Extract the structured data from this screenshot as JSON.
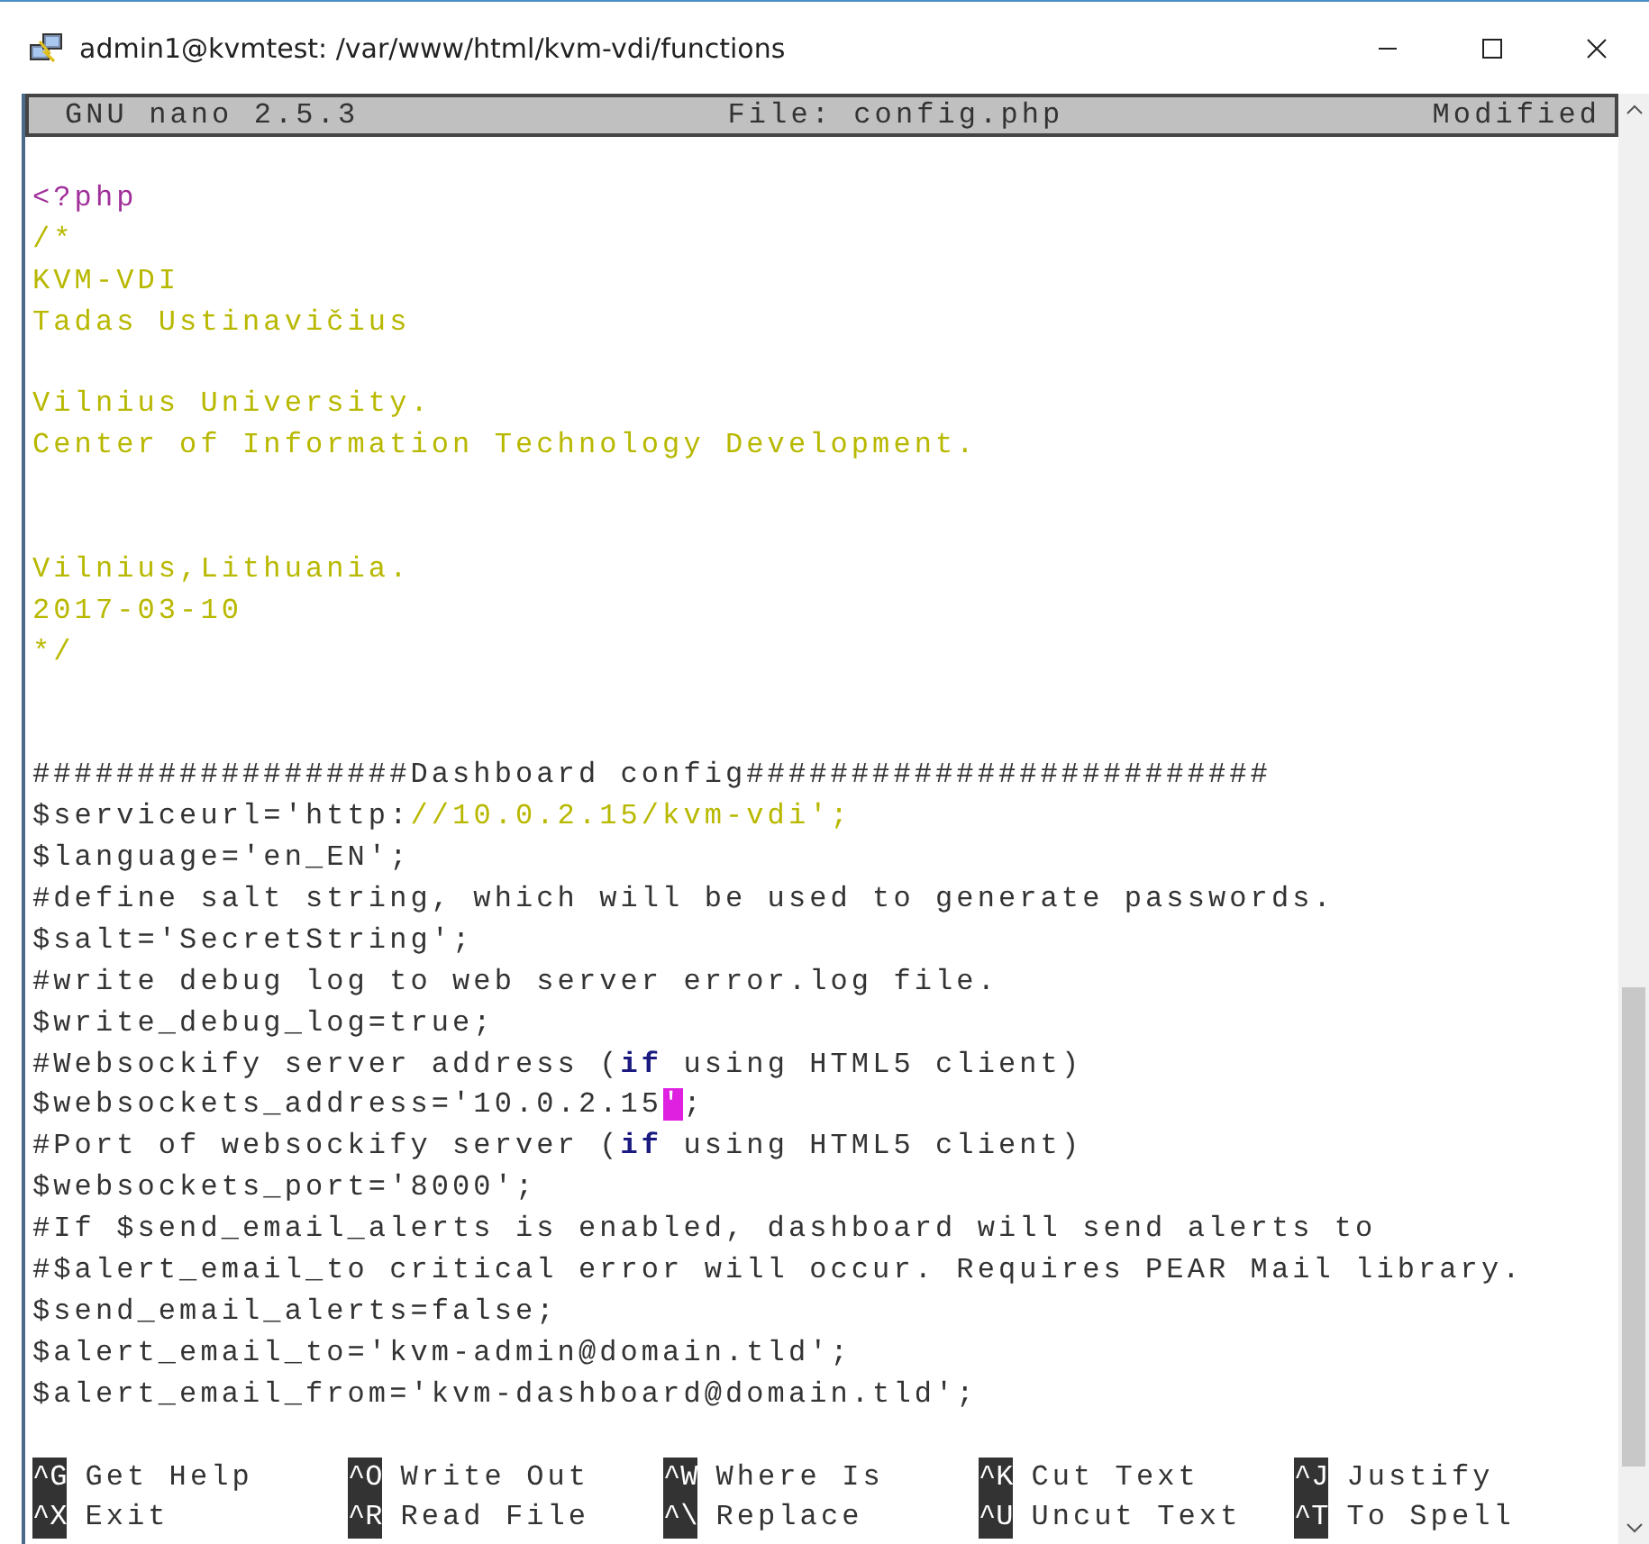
{
  "window": {
    "title": "admin1@kvmtest: /var/www/html/kvm-vdi/functions"
  },
  "status_bar": {
    "version": "GNU nano 2.5.3",
    "file": "File: config.php",
    "state": "Modified"
  },
  "lines": [
    {
      "kind": "blank"
    },
    {
      "kind": "code",
      "segments": [
        {
          "text": "<?php",
          "kind": "tag"
        }
      ]
    },
    {
      "kind": "code",
      "segments": [
        {
          "text": "/*",
          "kind": "comment"
        }
      ]
    },
    {
      "kind": "code",
      "segments": [
        {
          "text": "KVM-VDI",
          "kind": "comment"
        }
      ]
    },
    {
      "kind": "code",
      "segments": [
        {
          "text": "Tadas Ustinavičius",
          "kind": "comment"
        }
      ]
    },
    {
      "kind": "blank"
    },
    {
      "kind": "code",
      "segments": [
        {
          "text": "Vilnius University.",
          "kind": "comment"
        }
      ]
    },
    {
      "kind": "code",
      "segments": [
        {
          "text": "Center of Information Technology Development.",
          "kind": "comment"
        }
      ]
    },
    {
      "kind": "blank"
    },
    {
      "kind": "blank"
    },
    {
      "kind": "code",
      "segments": [
        {
          "text": "Vilnius,Lithuania.",
          "kind": "comment"
        }
      ]
    },
    {
      "kind": "code",
      "segments": [
        {
          "text": "2017-03-10",
          "kind": "comment"
        }
      ]
    },
    {
      "kind": "code",
      "segments": [
        {
          "text": "*/",
          "kind": "comment"
        }
      ]
    },
    {
      "kind": "blank"
    },
    {
      "kind": "blank"
    },
    {
      "kind": "code",
      "segments": [
        {
          "text": "##################Dashboard config#########################",
          "kind": "plain"
        }
      ]
    },
    {
      "kind": "code",
      "segments": [
        {
          "text": "$serviceurl='http:",
          "kind": "plain"
        },
        {
          "text": "//10.0.2.15/kvm-vdi';",
          "kind": "comment"
        }
      ]
    },
    {
      "kind": "code",
      "segments": [
        {
          "text": "$language='en_EN';",
          "kind": "plain"
        }
      ]
    },
    {
      "kind": "code",
      "segments": [
        {
          "text": "#define salt string, which will be used to generate passwords.",
          "kind": "plain"
        }
      ]
    },
    {
      "kind": "code",
      "segments": [
        {
          "text": "$salt='SecretString';",
          "kind": "plain"
        }
      ]
    },
    {
      "kind": "code",
      "segments": [
        {
          "text": "#write debug log to web server error.log file.",
          "kind": "plain"
        }
      ]
    },
    {
      "kind": "code",
      "segments": [
        {
          "text": "$write_debug_log=true;",
          "kind": "plain"
        }
      ]
    },
    {
      "kind": "code",
      "segments": [
        {
          "text": "#Websockify server address (",
          "kind": "plain"
        },
        {
          "text": "if",
          "kind": "keyword"
        },
        {
          "text": " using HTML5 client)",
          "kind": "plain"
        }
      ]
    },
    {
      "kind": "code",
      "segments": [
        {
          "text": "$websockets_address='10.0.2.15",
          "kind": "plain"
        },
        {
          "text": "'",
          "kind": "cursor"
        },
        {
          "text": ";",
          "kind": "plain"
        }
      ]
    },
    {
      "kind": "code",
      "segments": [
        {
          "text": "#Port of websockify server (",
          "kind": "plain"
        },
        {
          "text": "if",
          "kind": "keyword"
        },
        {
          "text": " using HTML5 client)",
          "kind": "plain"
        }
      ]
    },
    {
      "kind": "code",
      "segments": [
        {
          "text": "$websockets_port='8000';",
          "kind": "plain"
        }
      ]
    },
    {
      "kind": "code",
      "segments": [
        {
          "text": "#If $send_email_alerts is enabled, dashboard will send alerts to",
          "kind": "plain"
        }
      ]
    },
    {
      "kind": "code",
      "segments": [
        {
          "text": "#$alert_email_to critical error will occur. Requires PEAR Mail library.",
          "kind": "plain"
        }
      ]
    },
    {
      "kind": "code",
      "segments": [
        {
          "text": "$send_email_alerts=false;",
          "kind": "plain"
        }
      ]
    },
    {
      "kind": "code",
      "segments": [
        {
          "text": "$alert_email_to='kvm-admin@domain.tld';",
          "kind": "plain"
        }
      ]
    },
    {
      "kind": "code",
      "segments": [
        {
          "text": "$alert_email_from='kvm-dashboard@domain.tld';",
          "kind": "plain"
        }
      ]
    },
    {
      "kind": "blank"
    }
  ],
  "shortcuts": [
    [
      {
        "key": "^G",
        "label": "Get Help"
      },
      {
        "key": "^O",
        "label": "Write Out"
      },
      {
        "key": "^W",
        "label": "Where Is"
      },
      {
        "key": "^K",
        "label": "Cut Text"
      },
      {
        "key": "^J",
        "label": "Justify"
      }
    ],
    [
      {
        "key": "^X",
        "label": "Exit"
      },
      {
        "key": "^R",
        "label": "Read File"
      },
      {
        "key": "^\\",
        "label": "Replace"
      },
      {
        "key": "^U",
        "label": "Uncut Text"
      },
      {
        "key": "^T",
        "label": "To Spell"
      }
    ]
  ]
}
